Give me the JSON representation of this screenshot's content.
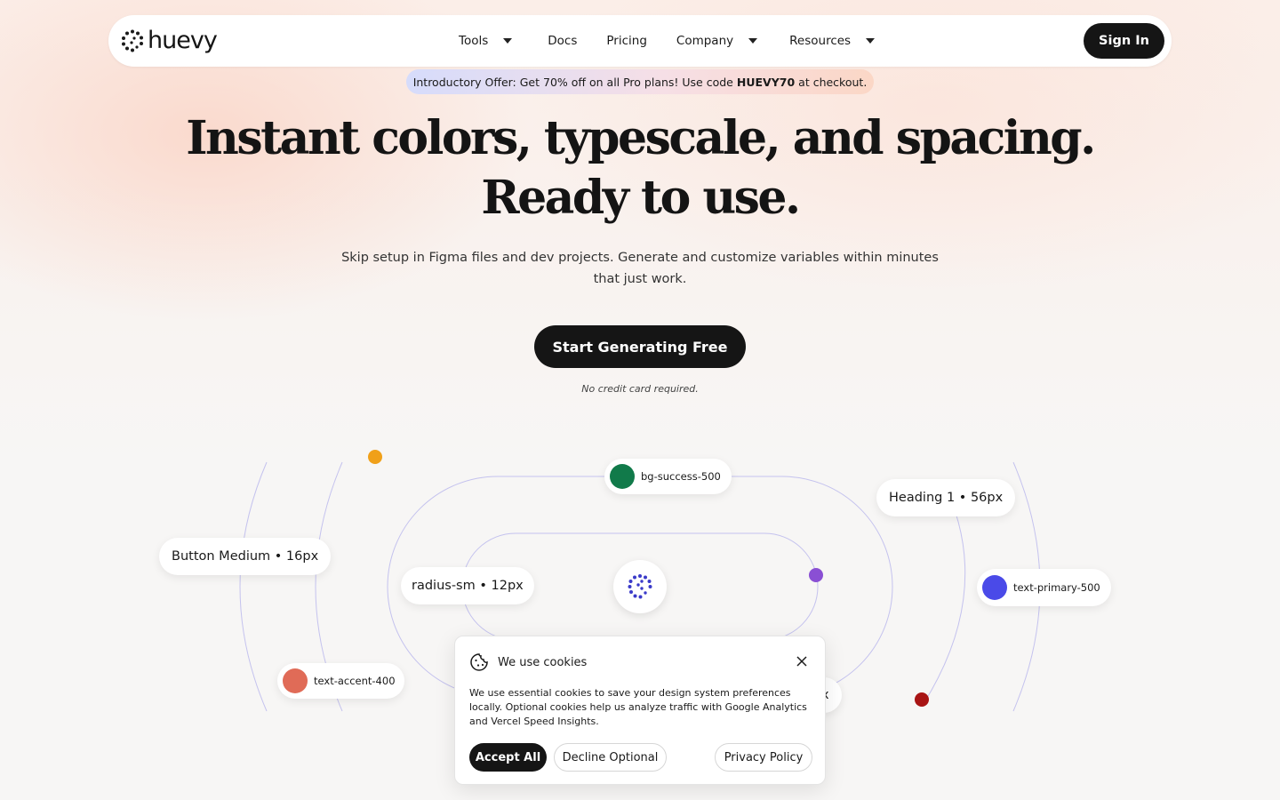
{
  "brand": {
    "logo_text": "huevy"
  },
  "nav": {
    "links": [
      {
        "label": "Tools",
        "has_dropdown": true
      },
      {
        "label": "Docs",
        "has_dropdown": false
      },
      {
        "label": "Pricing",
        "has_dropdown": false
      },
      {
        "label": "Company",
        "has_dropdown": true
      },
      {
        "label": "Resources",
        "has_dropdown": true
      }
    ],
    "sign_in_label": "Sign In"
  },
  "promo": {
    "prefix": "Introductory Offer: Get 70% off on all Pro plans! Use code",
    "code": "HUEVY70",
    "suffix": "at checkout."
  },
  "hero": {
    "title_line1": "Instant colors, typescale, and spacing.",
    "title_line2": "Ready to use.",
    "subtitle": "Skip setup in Figma files and dev projects. Generate and customize variables within minutes that just work.",
    "cta_label": "Start Generating Free",
    "cta_note": "No credit card required."
  },
  "tokens": {
    "bg_success": {
      "label": "bg-success-500",
      "color": "#117a4a"
    },
    "heading": {
      "label": "Heading 1 • 56px"
    },
    "button_medium": {
      "label": "Button Medium • 16px"
    },
    "radius": {
      "label": "radius-sm • 12px"
    },
    "text_primary": {
      "label": "text-primary-500",
      "color": "#4a4ae8"
    },
    "text_accent": {
      "label": "text-accent-400",
      "color": "#e06b57"
    },
    "partial": {
      "label": "x"
    }
  },
  "accent_dots": {
    "orange": "#f0a019",
    "purple": "#8a4fd4",
    "red": "#a81414"
  },
  "cookie": {
    "title": "We use cookies",
    "body": "We use essential cookies to save your design system preferences locally. Optional cookies help us analyze traffic with Google Analytics and Vercel Speed Insights.",
    "accept_label": "Accept All",
    "decline_label": "Decline Optional",
    "privacy_label": "Privacy Policy"
  },
  "colors": {
    "primary_dark": "#151515",
    "orbit_stroke": "#b9b7ee"
  }
}
